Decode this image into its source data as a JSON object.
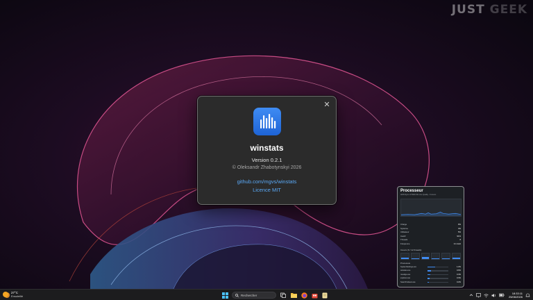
{
  "watermark": {
    "left": "JUST",
    "right": "GEEK"
  },
  "about": {
    "app_name": "winstats",
    "version": "Version 0.2.1",
    "copyright": "© Oleksandr Zhabotynskyi 2026",
    "github_link": "github.com/mgvs/winstats",
    "licence_link": "Licence MIT",
    "close_icon": "close-icon",
    "accent_color": "#3f8cf3"
  },
  "widget": {
    "title": "Processeur",
    "subtitle": "AMD Ryzen 9 5900 6th core Quality - 6 cœurs",
    "stats": [
      {
        "label": "Charge",
        "value": "9%"
      },
      {
        "label": "Système",
        "value": "4%"
      },
      {
        "label": "Utilisateur",
        "value": "5%"
      },
      {
        "label": "Inactif",
        "value": "91%"
      },
      {
        "label": "Threads",
        "value": "8"
      },
      {
        "label": "Fréquence",
        "value": "3.1 GHz"
      }
    ],
    "cores_label": "Cœurs (6 / 12 threads)",
    "cores": [
      0.15,
      0.1,
      0.3,
      0.08,
      0.12,
      0.2
    ],
    "top_label": "Processus",
    "processes": [
      {
        "name": "SystemSettings.exe",
        "value": "1.2%",
        "level": 0.12
      },
      {
        "name": "winstats.exe",
        "value": "0.6%",
        "level": 0.06
      },
      {
        "name": "msedge.exe",
        "value": "0.4%",
        "level": 0.04
      },
      {
        "name": "explorer.exe",
        "value": "0.3%",
        "level": 0.03
      },
      {
        "name": "SearchIndexer.exe",
        "value": "0.2%",
        "level": 0.02
      }
    ]
  },
  "taskbar": {
    "weather_temp": "27°C",
    "weather_desc": "Ensoleillé",
    "search_placeholder": "Rechercher",
    "time": "18:33:11",
    "date": "25/06/2026"
  }
}
